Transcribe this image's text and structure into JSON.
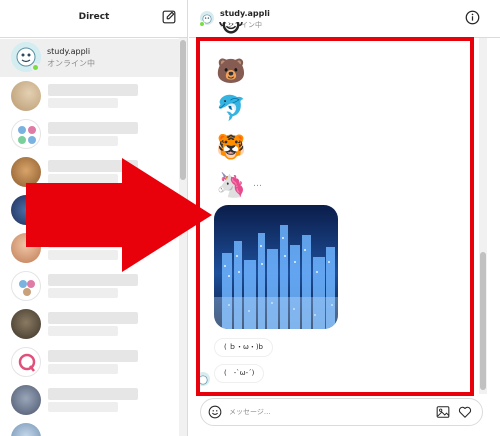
{
  "sidebar": {
    "title": "Direct",
    "active_contact": {
      "name": "study.appli",
      "status": "オンライン中"
    }
  },
  "chat": {
    "header": {
      "name": "study.appli",
      "status": "オンライン中"
    },
    "messages": {
      "emojis": [
        "🐻",
        "🐬",
        "🐯",
        "🦄"
      ],
      "more": "…",
      "bubble_1": "( ｂ・ω・)b",
      "bubble_2": "(　-`ω-´)"
    }
  },
  "composer": {
    "placeholder": "メッセージ..."
  },
  "annotation": {
    "highlight_color": "#e8000b"
  },
  "icons": [
    "compose-icon",
    "info-icon",
    "smile-icon",
    "image-icon",
    "heart-icon"
  ]
}
